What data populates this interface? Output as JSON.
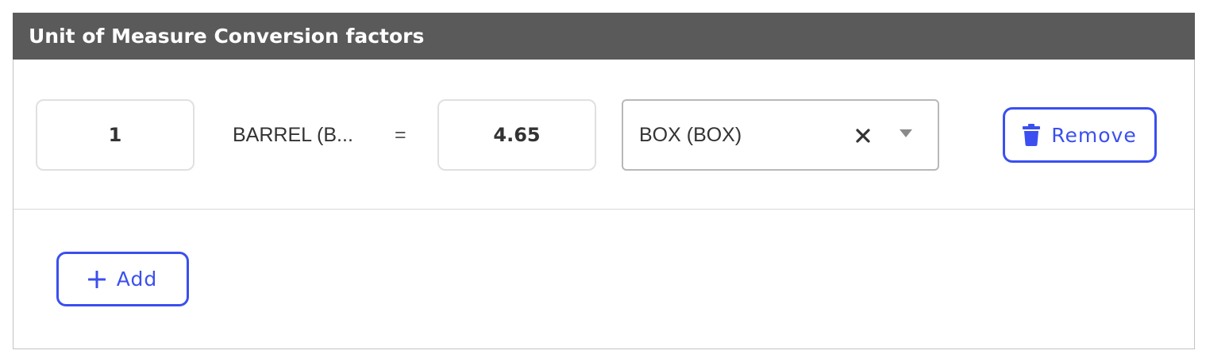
{
  "panel": {
    "title": "Unit of Measure Conversion factors"
  },
  "conversion_row": {
    "from_quantity": "1",
    "from_unit": "BARREL (B...",
    "equals_sign": "=",
    "to_quantity": "4.65",
    "to_unit_selected": "BOX (BOX)",
    "remove_label": "Remove"
  },
  "actions": {
    "add_label": "Add"
  },
  "colors": {
    "header_bg": "#5a5a5a",
    "accent": "#3b4ff0",
    "border": "#c3c3c3"
  },
  "icons": {
    "remove": "trash-icon",
    "add": "plus-icon",
    "clear": "close-icon",
    "dropdown": "chevron-down-icon"
  }
}
